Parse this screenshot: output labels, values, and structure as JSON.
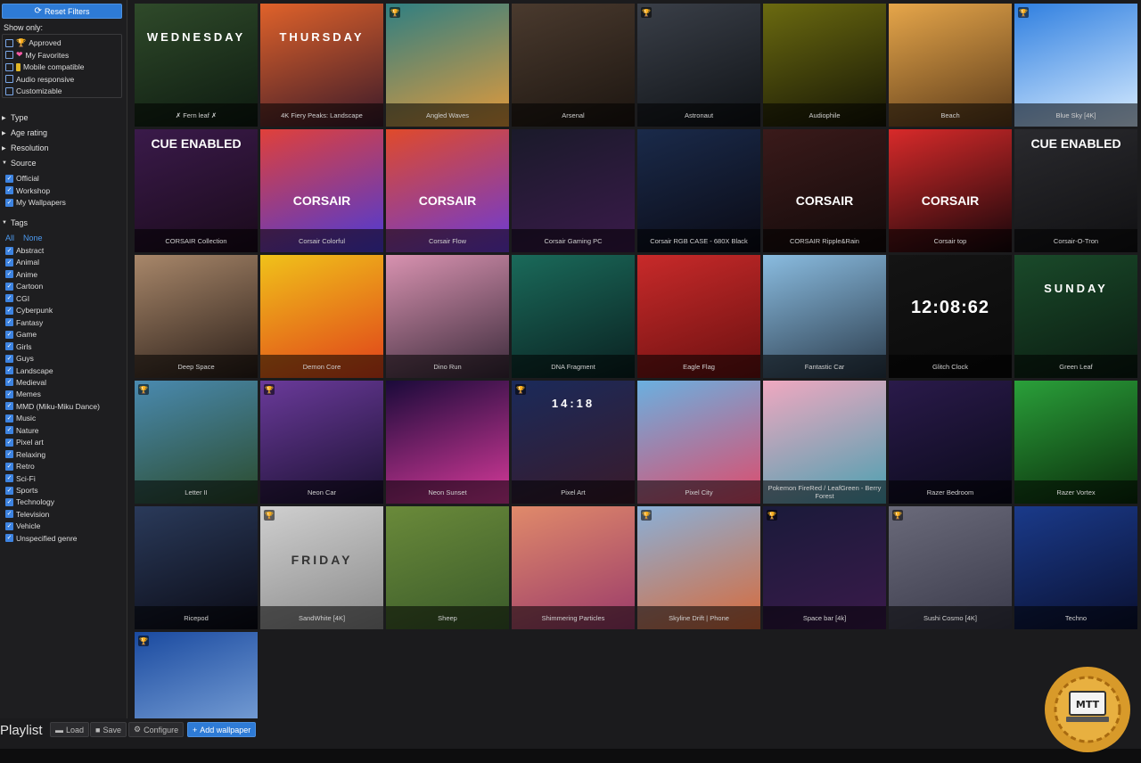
{
  "sidebar": {
    "reset_label": "Reset Filters",
    "show_only_label": "Show only:",
    "show_only": [
      {
        "label": "Approved",
        "icon": "trophy-icon",
        "checked": false
      },
      {
        "label": "My Favorites",
        "icon": "heart-icon",
        "checked": false
      },
      {
        "label": "Mobile compatible",
        "icon": "phone-icon",
        "checked": false
      },
      {
        "label": "Audio responsive",
        "icon": "",
        "checked": false
      },
      {
        "label": "Customizable",
        "icon": "",
        "checked": false
      }
    ],
    "sections": {
      "type": "Type",
      "age": "Age rating",
      "resolution": "Resolution",
      "source": "Source",
      "tags": "Tags"
    },
    "source_items": [
      "Official",
      "Workshop",
      "My Wallpapers"
    ],
    "tags_all": "All",
    "tags_none": "None",
    "tags": [
      "Abstract",
      "Animal",
      "Anime",
      "Cartoon",
      "CGI",
      "Cyberpunk",
      "Fantasy",
      "Game",
      "Girls",
      "Guys",
      "Landscape",
      "Medieval",
      "Memes",
      "MMD (Miku-Miku Dance)",
      "Music",
      "Nature",
      "Pixel art",
      "Relaxing",
      "Retro",
      "Sci-Fi",
      "Sports",
      "Technology",
      "Television",
      "Vehicle",
      "Unspecified genre"
    ]
  },
  "wallpapers": [
    {
      "title": "✗ Fern leaf ✗",
      "art": "WEDNESDAY",
      "badge": false,
      "colors": [
        "#2f4a2a",
        "#0d1a10"
      ]
    },
    {
      "title": "4K Fiery Peaks: Landscape",
      "art": "THURSDAY",
      "badge": false,
      "colors": [
        "#e0622a",
        "#3a1a2a"
      ]
    },
    {
      "title": "Angled Waves",
      "art": "",
      "badge": true,
      "colors": [
        "#2f7f82",
        "#e39a3b"
      ]
    },
    {
      "title": "Arsenal",
      "art": "",
      "badge": false,
      "colors": [
        "#4a3a2e",
        "#1c1510"
      ]
    },
    {
      "title": "Astronaut",
      "art": "",
      "badge": true,
      "colors": [
        "#3a3f48",
        "#0f1216"
      ]
    },
    {
      "title": "Audiophile",
      "art": "",
      "badge": false,
      "colors": [
        "#6b6a10",
        "#151505"
      ]
    },
    {
      "title": "Beach",
      "art": "",
      "badge": false,
      "colors": [
        "#e6a64a",
        "#5a3a1a"
      ]
    },
    {
      "title": "Blue Sky [4K]",
      "art": "",
      "badge": true,
      "colors": [
        "#2f7fe0",
        "#d8ecff"
      ]
    },
    {
      "title": "CORSAIR Collection",
      "art": "CUE ENABLED",
      "badge": false,
      "colors": [
        "#3a1a4a",
        "#1a0a1a"
      ]
    },
    {
      "title": "Corsair Colorful",
      "art": "CORSAIR",
      "badge": false,
      "colors": [
        "#e0403a",
        "#4a3ad8"
      ]
    },
    {
      "title": "Corsair Flow",
      "art": "CORSAIR",
      "badge": false,
      "colors": [
        "#e04a2a",
        "#6a3ad8"
      ]
    },
    {
      "title": "Corsair Gaming PC",
      "art": "",
      "badge": false,
      "colors": [
        "#1a1a2a",
        "#3a1a4a"
      ]
    },
    {
      "title": "Corsair RGB CASE - 680X Black",
      "art": "",
      "badge": false,
      "colors": [
        "#1a2a4a",
        "#0a0a14"
      ]
    },
    {
      "title": "CORSAIR Ripple&Rain",
      "art": "CORSAIR",
      "badge": false,
      "colors": [
        "#3a1a1a",
        "#120a0a"
      ]
    },
    {
      "title": "Corsair top",
      "art": "CORSAIR",
      "badge": false,
      "colors": [
        "#d82a2a",
        "#14060a"
      ]
    },
    {
      "title": "Corsair-O-Tron",
      "art": "CUE ENABLED",
      "badge": false,
      "colors": [
        "#2a2a2e",
        "#101012"
      ]
    },
    {
      "title": "Deep Space",
      "art": "",
      "badge": false,
      "colors": [
        "#a8876a",
        "#2a1e18"
      ]
    },
    {
      "title": "Demon Core",
      "art": "",
      "badge": false,
      "colors": [
        "#f0c21a",
        "#e0401a"
      ]
    },
    {
      "title": "Dino Run",
      "art": "",
      "badge": false,
      "colors": [
        "#d892b0",
        "#3a2a3a"
      ]
    },
    {
      "title": "DNA Fragment",
      "art": "",
      "badge": false,
      "colors": [
        "#1a6a5a",
        "#0a2020"
      ]
    },
    {
      "title": "Eagle Flag",
      "art": "",
      "badge": false,
      "colors": [
        "#c82a2a",
        "#6a1010"
      ]
    },
    {
      "title": "Fantastic Car",
      "art": "",
      "badge": false,
      "colors": [
        "#8abce0",
        "#2a3a4a"
      ]
    },
    {
      "title": "Glitch Clock",
      "art": "12:08:62",
      "badge": false,
      "colors": [
        "#141414",
        "#0a0a0a"
      ]
    },
    {
      "title": "Green Leaf",
      "art": "SUNDAY",
      "badge": false,
      "colors": [
        "#1a4a2a",
        "#0a1a10"
      ]
    },
    {
      "title": "Letter II",
      "art": "",
      "badge": true,
      "colors": [
        "#4a8ab0",
        "#2a4a2a"
      ]
    },
    {
      "title": "Neon Car",
      "art": "",
      "badge": true,
      "colors": [
        "#6a3a9a",
        "#1a1030"
      ]
    },
    {
      "title": "Neon Sunset",
      "art": "",
      "badge": false,
      "colors": [
        "#1a0a3a",
        "#d83a9a"
      ]
    },
    {
      "title": "Pixel Art",
      "art": "14:18",
      "badge": true,
      "colors": [
        "#1a2a5a",
        "#3a1a2a"
      ]
    },
    {
      "title": "Pixel City",
      "art": "",
      "badge": false,
      "colors": [
        "#6ab0e0",
        "#e04a6a"
      ]
    },
    {
      "title": "Pokemon FireRed / LeafGreen - Berry Forest",
      "art": "",
      "badge": false,
      "colors": [
        "#f0a8c0",
        "#4aa0b0"
      ]
    },
    {
      "title": "Razer Bedroom",
      "art": "",
      "badge": false,
      "colors": [
        "#2a1a4a",
        "#0a0a1a"
      ]
    },
    {
      "title": "Razer Vortex",
      "art": "",
      "badge": false,
      "colors": [
        "#2aa03a",
        "#0a2a0a"
      ]
    },
    {
      "title": "Ricepod",
      "art": "",
      "badge": false,
      "colors": [
        "#2a3a5a",
        "#0a0a14"
      ]
    },
    {
      "title": "SandWhite [4K]",
      "art": "FRIDAY",
      "badge": true,
      "colors": [
        "#cfcfcf",
        "#8a8a8a"
      ]
    },
    {
      "title": "Sheep",
      "art": "",
      "badge": false,
      "colors": [
        "#6a8a3a",
        "#3a5a2a"
      ]
    },
    {
      "title": "Shimmering Particles",
      "art": "",
      "badge": false,
      "colors": [
        "#e08a6a",
        "#9a3a6a"
      ]
    },
    {
      "title": "Skyline Drift | Phone",
      "art": "",
      "badge": true,
      "colors": [
        "#8ab0d8",
        "#d86a3a"
      ]
    },
    {
      "title": "Space bar [4k]",
      "art": "",
      "badge": true,
      "colors": [
        "#1a1a3a",
        "#3a1a4a"
      ]
    },
    {
      "title": "Sushi Cosmo [4K]",
      "art": "",
      "badge": true,
      "colors": [
        "#6a6a7a",
        "#3a3a4a"
      ]
    },
    {
      "title": "Techno",
      "art": "",
      "badge": false,
      "colors": [
        "#1a3a8a",
        "#0a1030"
      ]
    },
    {
      "title": "",
      "art": "",
      "badge": true,
      "colors": [
        "#1a4aa0",
        "#8ab0e0"
      ]
    }
  ],
  "footer": {
    "playlist": "Playlist",
    "load": "Load",
    "save": "Save",
    "configure": "Configure",
    "add": "Add wallpaper"
  },
  "watermark": {
    "text": "MTT"
  }
}
